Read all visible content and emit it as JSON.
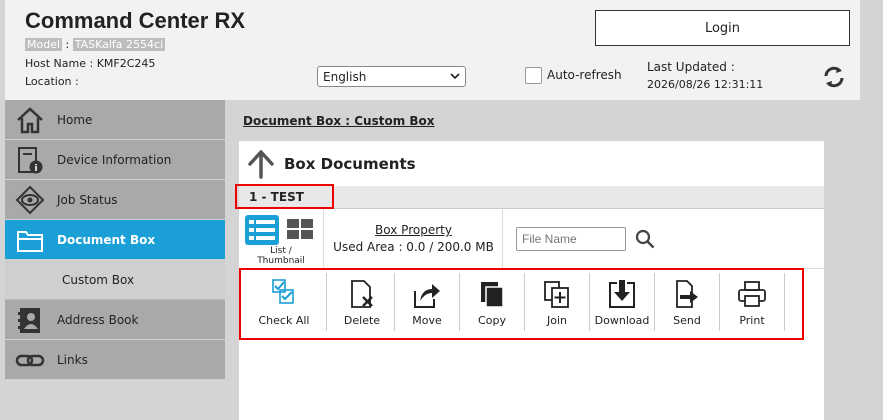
{
  "header": {
    "title": "Command Center RX",
    "model_label": "Model",
    "model_value": "TASKalfa 2554ci",
    "hostname_label": "Host Name :",
    "hostname_value": "KMF2C245",
    "location_label": "Location :",
    "login_label": "Login",
    "language": "English",
    "autorefresh_label": "Auto-refresh",
    "last_updated_label": "Last Updated :",
    "last_updated_value": "2026/08/26 12:31:11"
  },
  "sidebar": {
    "items": [
      {
        "label": "Home"
      },
      {
        "label": "Device Information"
      },
      {
        "label": "Job Status"
      },
      {
        "label": "Document Box"
      },
      {
        "label": "Custom Box"
      },
      {
        "label": "Address Book"
      },
      {
        "label": "Links"
      }
    ]
  },
  "main": {
    "breadcrumb": "Document Box : Custom Box",
    "title": "Box Documents",
    "box_name": "1 - TEST",
    "view_toggle_label": "List / Thumbnail",
    "box_property_link": "Box Property",
    "used_area": "Used Area : 0.0 / 200.0 MB",
    "file_name_placeholder": "File Name"
  },
  "actions": [
    {
      "label": "Check All"
    },
    {
      "label": "Delete"
    },
    {
      "label": "Move"
    },
    {
      "label": "Copy"
    },
    {
      "label": "Join"
    },
    {
      "label": "Download"
    },
    {
      "label": "Send"
    },
    {
      "label": "Print"
    }
  ],
  "colors": {
    "accent": "#1aa0d6",
    "highlight_frame": "#e00000"
  }
}
